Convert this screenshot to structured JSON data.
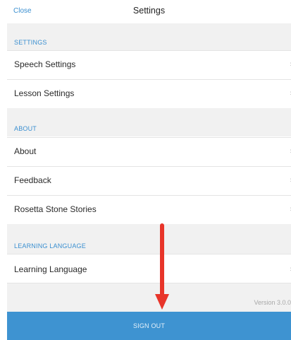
{
  "header": {
    "close_label": "Close",
    "title": "Settings"
  },
  "sections": {
    "settings": {
      "title": "SETTINGS",
      "items": [
        {
          "label": "Speech Settings",
          "chevron": "chevron-right-icon"
        },
        {
          "label": "Lesson Settings",
          "chevron": "chevron-right-icon"
        }
      ]
    },
    "about": {
      "title": "ABOUT",
      "items": [
        {
          "label": "About",
          "chevron": "chevron-right-icon"
        },
        {
          "label": "Feedback",
          "chevron": "chevron-right-icon"
        },
        {
          "label": "Rosetta Stone Stories",
          "chevron": "chevron-right-icon"
        }
      ]
    },
    "learning_language": {
      "title": "LEARNING LANGUAGE",
      "items": [
        {
          "label": "Learning Language",
          "chevron": "chevron-right-icon"
        }
      ]
    }
  },
  "footer": {
    "version": "Version 3.0.0",
    "sign_out_label": "SIGN OUT"
  },
  "annotation": {
    "arrow_color": "#e8352a",
    "arrow_icon": "down-arrow-annotation"
  },
  "colors": {
    "accent": "#3a8fd0",
    "sign_out_bg": "#3e93d1",
    "section_bg": "#f1f1f1"
  }
}
